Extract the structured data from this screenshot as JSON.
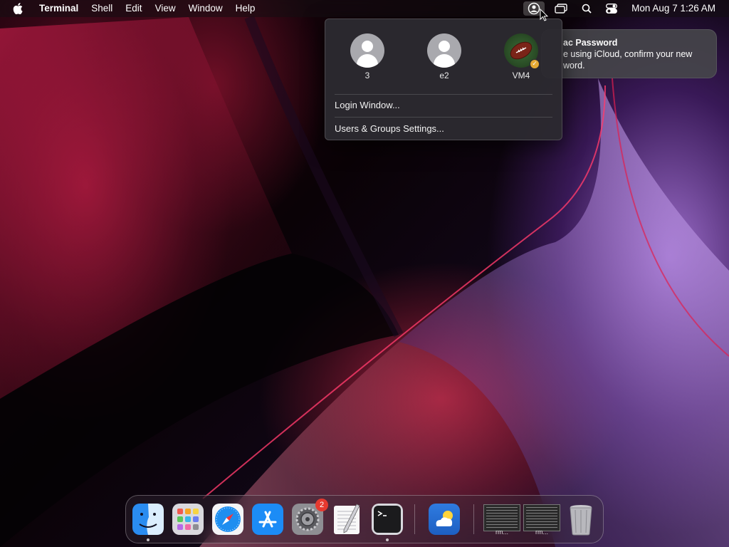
{
  "menubar": {
    "app_name": "Terminal",
    "menus": [
      "Shell",
      "Edit",
      "View",
      "Window",
      "Help"
    ],
    "status_icons": [
      "user-account-icon",
      "screen-mirroring-icon",
      "spotlight-search-icon",
      "control-center-icon"
    ],
    "clock": "Mon Aug 7  1:26 AM"
  },
  "notification": {
    "title": "ac Password",
    "body": "e using iCloud, confirm your new\nword."
  },
  "user_menu": {
    "users": [
      {
        "name": "3",
        "avatar": "generic-user-icon"
      },
      {
        "name": "e2",
        "avatar": "generic-user-icon"
      },
      {
        "name": "VM4",
        "avatar": "football-icon",
        "logged_in": true
      }
    ],
    "items": [
      "Login Window...",
      "Users & Groups Settings..."
    ]
  },
  "dock": {
    "apps": [
      {
        "name": "Finder",
        "icon": "finder-icon",
        "running": true
      },
      {
        "name": "Launchpad",
        "icon": "launchpad-icon"
      },
      {
        "name": "Safari",
        "icon": "safari-icon"
      },
      {
        "name": "App Store",
        "icon": "app-store-icon"
      },
      {
        "name": "System Settings",
        "icon": "system-settings-icon",
        "badge": "2"
      },
      {
        "name": "TextEdit",
        "icon": "textedit-icon"
      },
      {
        "name": "Terminal",
        "icon": "terminal-icon",
        "running": true
      },
      {
        "name": "Weather",
        "icon": "weather-icon"
      }
    ],
    "minimized": [
      {
        "label": "rm..."
      },
      {
        "label": "rm..."
      }
    ],
    "trash": {
      "icon": "trash-icon"
    }
  }
}
